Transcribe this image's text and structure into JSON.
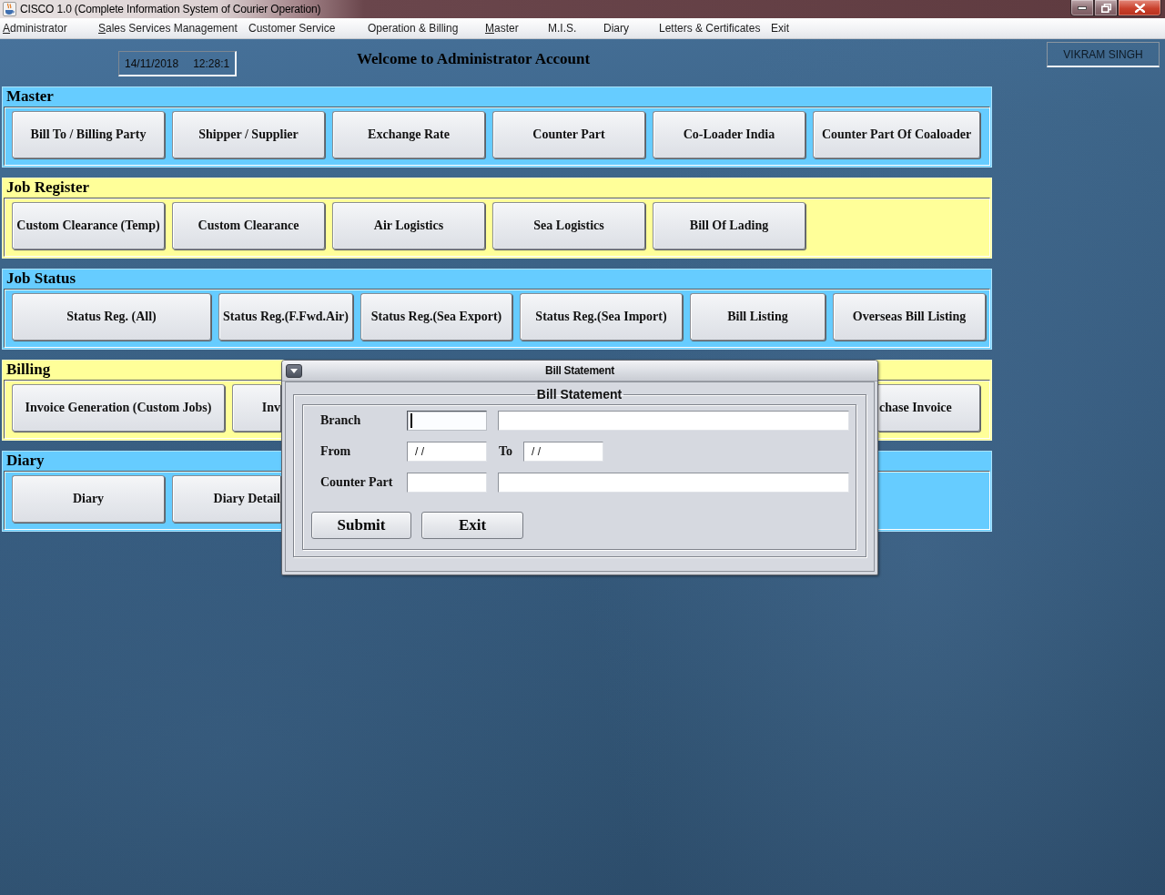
{
  "window": {
    "title": "CISCO 1.0 (Complete Information System of Courier Operation)"
  },
  "menu_bar": [
    {
      "label": "Administrator",
      "mnemonic": true
    },
    {
      "label": "Sales Services Management",
      "mnemonic": true
    },
    {
      "label": "Customer Service",
      "mnemonic": false
    },
    {
      "label": "Operation & Billing",
      "mnemonic": false
    },
    {
      "label": "Master",
      "mnemonic": true
    },
    {
      "label": "M.I.S.",
      "mnemonic": false
    },
    {
      "label": "Diary",
      "mnemonic": false
    },
    {
      "label": "Letters & Certificates",
      "mnemonic": false
    },
    {
      "label": "Exit",
      "mnemonic": false
    }
  ],
  "header": {
    "date": "14/11/2018",
    "time": "12:28:1",
    "welcome": "Welcome to Administrator Account",
    "user": "VIKRAM SINGH"
  },
  "sections": [
    {
      "title": "Master",
      "color": "#66ccff",
      "buttons": [
        {
          "label": "Bill To / Billing Party"
        },
        {
          "label": "Shipper / Supplier"
        },
        {
          "label": "Exchange Rate"
        },
        {
          "label": "Counter Part"
        },
        {
          "label": "Co-Loader India"
        },
        {
          "label": "Counter Part Of Coaloader"
        }
      ]
    },
    {
      "title": "Job Register",
      "color": "#ffff99",
      "buttons": [
        {
          "label": "Custom Clearance (Temp)"
        },
        {
          "label": "Custom Clearance"
        },
        {
          "label": "Air Logistics"
        },
        {
          "label": "Sea Logistics"
        },
        {
          "label": "Bill Of Lading"
        }
      ]
    },
    {
      "title": "Job Status",
      "color": "#66ccff",
      "buttons": [
        {
          "label": "Status Reg. (All)"
        },
        {
          "label": "Status Reg.(F.Fwd.Air)"
        },
        {
          "label": "Status Reg.(Sea Export)"
        },
        {
          "label": "Status Reg.(Sea Import)"
        },
        {
          "label": "Bill Listing"
        },
        {
          "label": "Overseas Bill Listing"
        }
      ]
    },
    {
      "title": "Billing",
      "color": "#ffff99",
      "buttons": [
        {
          "label": "Invoice Generation (Custom Jobs)",
          "kind": "full"
        },
        {
          "label": "Inv",
          "kind": "cut_right"
        },
        {
          "label": "chase Invoice",
          "kind": "cut_left"
        }
      ]
    },
    {
      "title": "Diary",
      "color": "#66ccff",
      "buttons": [
        {
          "label": "Diary",
          "kind": "full"
        },
        {
          "label": "Diary Detail",
          "kind": "cut_right"
        }
      ]
    }
  ],
  "dialog": {
    "title": "Bill Statement",
    "group_title": "Bill Statement",
    "rows": [
      {
        "kind": "lookup",
        "label": "Branch",
        "focused": true
      },
      {
        "kind": "range",
        "label": "From",
        "value": "/ /",
        "to_label": "To",
        "to_value": "/ /"
      },
      {
        "kind": "lookup",
        "label": "Counter Part",
        "focused": false
      }
    ],
    "buttons": [
      "Submit",
      "Exit"
    ]
  }
}
